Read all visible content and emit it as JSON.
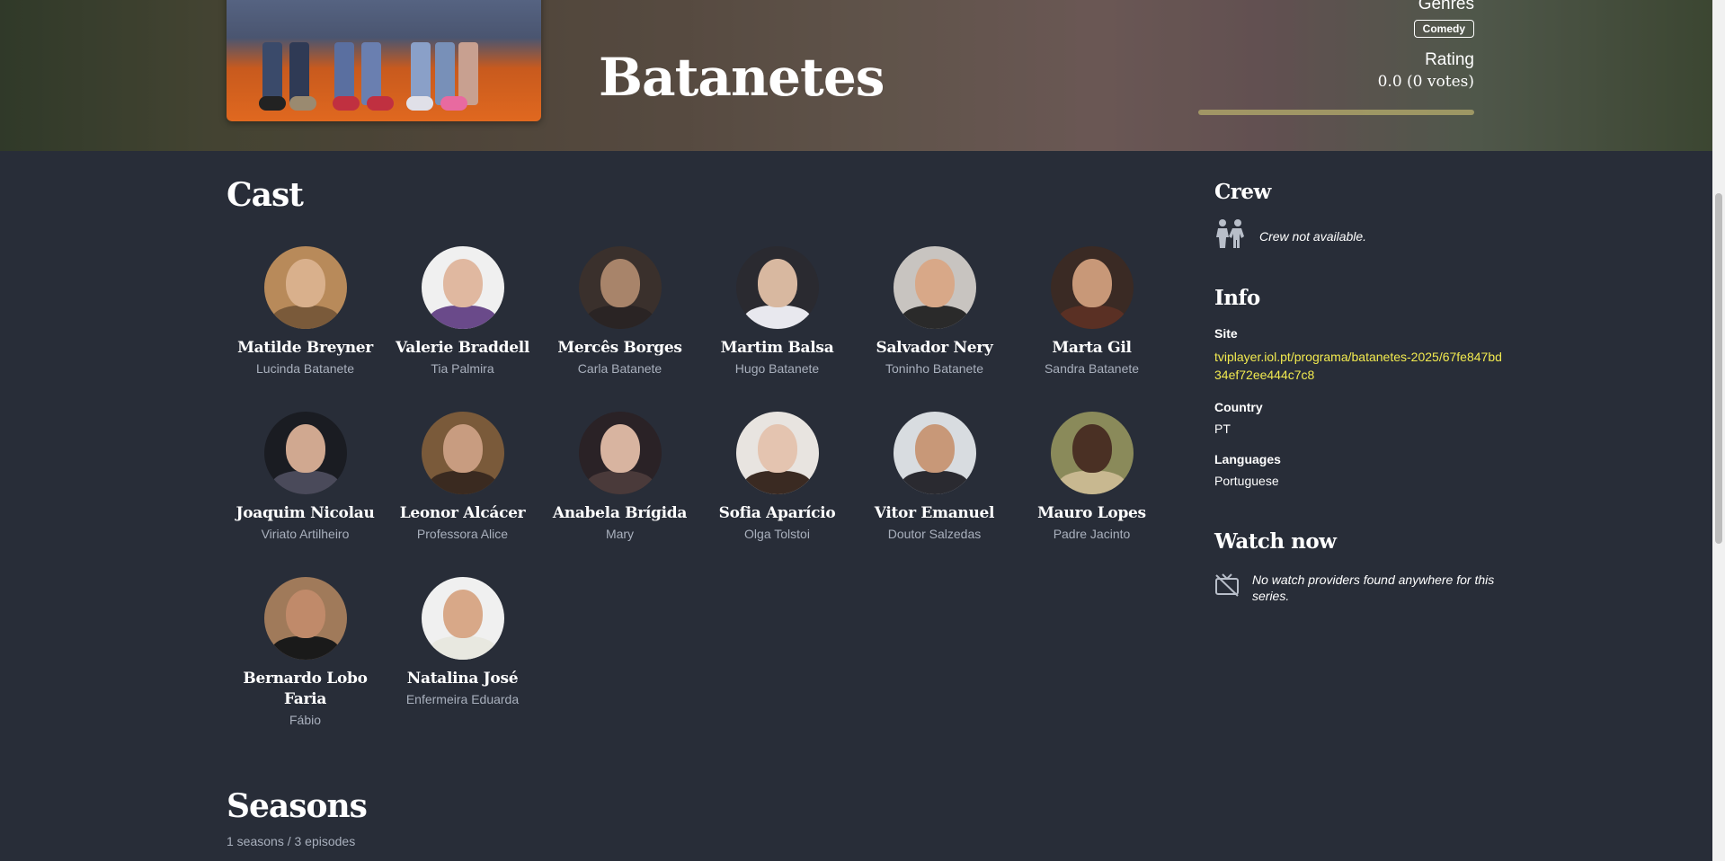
{
  "show": {
    "title": "Batanetes",
    "genres_label": "Genres",
    "genre": "Comedy",
    "rating_label": "Rating",
    "rating_value": "0.0",
    "rating_votes": "(0 votes)"
  },
  "cast": {
    "heading": "Cast",
    "members": [
      {
        "name": "Matilde Breyner",
        "role": "Lucinda Batanete"
      },
      {
        "name": "Valerie Braddell",
        "role": "Tia Palmira"
      },
      {
        "name": "Mercês Borges",
        "role": "Carla Batanete"
      },
      {
        "name": "Martim Balsa",
        "role": "Hugo Batanete"
      },
      {
        "name": "Salvador Nery",
        "role": "Toninho Batanete"
      },
      {
        "name": "Marta Gil",
        "role": "Sandra Batanete"
      },
      {
        "name": "Joaquim Nicolau",
        "role": "Viriato Artilheiro"
      },
      {
        "name": "Leonor Alcácer",
        "role": "Professora Alice"
      },
      {
        "name": "Anabela Brígida",
        "role": "Mary"
      },
      {
        "name": "Sofia Aparício",
        "role": "Olga Tolstoi"
      },
      {
        "name": "Vitor Emanuel",
        "role": "Doutor Salzedas"
      },
      {
        "name": "Mauro Lopes",
        "role": "Padre Jacinto"
      },
      {
        "name": "Bernardo Lobo Faria",
        "role": "Fábio"
      },
      {
        "name": "Natalina José",
        "role": "Enfermeira Eduarda"
      }
    ]
  },
  "seasons": {
    "heading": "Seasons",
    "summary": "1 seasons / 3 episodes"
  },
  "crew": {
    "heading": "Crew",
    "empty_note": "Crew not available.",
    "icon": "people-icon"
  },
  "info": {
    "heading": "Info",
    "site_label": "Site",
    "site_value": "tviplayer.iol.pt/programa/batanetes-2025/67fe847bd34ef72ee444c7c8",
    "country_label": "Country",
    "country_value": "PT",
    "languages_label": "Languages",
    "languages_value": "Portuguese"
  },
  "watch": {
    "heading": "Watch now",
    "empty_note": "No watch providers found anywhere for this series.",
    "icon": "tv-off-icon"
  },
  "colors": {
    "background": "#282d38",
    "link": "#f2ea4f",
    "muted": "#a9b0bd"
  }
}
